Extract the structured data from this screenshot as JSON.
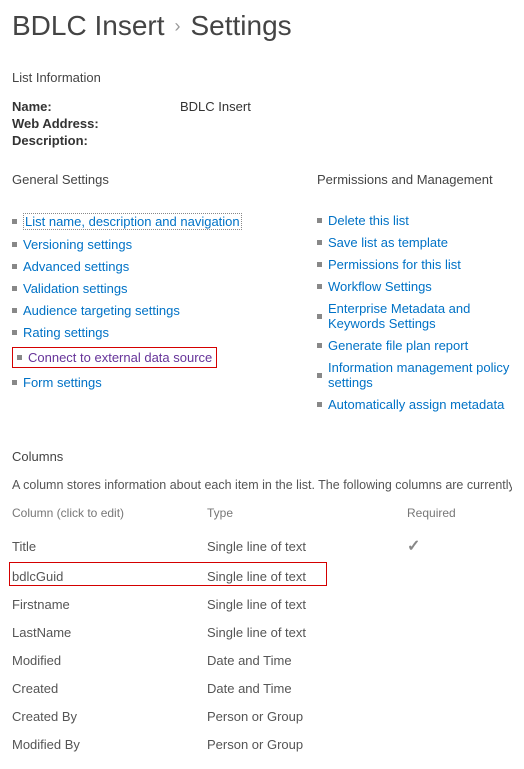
{
  "breadcrumb": {
    "parent": "BDLC Insert",
    "current": "Settings"
  },
  "listInfo": {
    "heading": "List Information",
    "nameLabel": "Name:",
    "nameValue": "BDLC Insert",
    "webLabel": "Web Address:",
    "webValue": "",
    "descLabel": "Description:",
    "descValue": ""
  },
  "general": {
    "heading": "General Settings",
    "items": [
      {
        "label": "List name, description and navigation",
        "style": "dotted"
      },
      {
        "label": "Versioning settings"
      },
      {
        "label": "Advanced settings"
      },
      {
        "label": "Validation settings"
      },
      {
        "label": "Audience targeting settings"
      },
      {
        "label": "Rating settings"
      },
      {
        "label": "Connect to external data source",
        "highlight": true,
        "visited": true
      },
      {
        "label": "Form settings"
      }
    ]
  },
  "permissions": {
    "heading": "Permissions and Management",
    "items": [
      {
        "label": "Delete this list"
      },
      {
        "label": "Save list as template"
      },
      {
        "label": "Permissions for this list"
      },
      {
        "label": "Workflow Settings"
      },
      {
        "label": "Enterprise Metadata and Keywords Settings"
      },
      {
        "label": "Generate file plan report"
      },
      {
        "label": "Information management policy settings"
      },
      {
        "label": "Automatically assign metadata"
      }
    ]
  },
  "columns": {
    "heading": "Columns",
    "desc": "A column stores information about each item in the list. The following columns are currently availa",
    "headers": {
      "name": "Column (click to edit)",
      "type": "Type",
      "required": "Required"
    },
    "rows": [
      {
        "name": "Title",
        "type": "Single line of text",
        "required": true
      },
      {
        "name": "bdlcGuid",
        "type": "Single line of text",
        "highlight": true
      },
      {
        "name": "Firstname",
        "type": "Single line of text"
      },
      {
        "name": "LastName",
        "type": "Single line of text"
      },
      {
        "name": "Modified",
        "type": "Date and Time"
      },
      {
        "name": "Created",
        "type": "Date and Time"
      },
      {
        "name": "Created By",
        "type": "Person or Group"
      },
      {
        "name": "Modified By",
        "type": "Person or Group"
      }
    ]
  }
}
